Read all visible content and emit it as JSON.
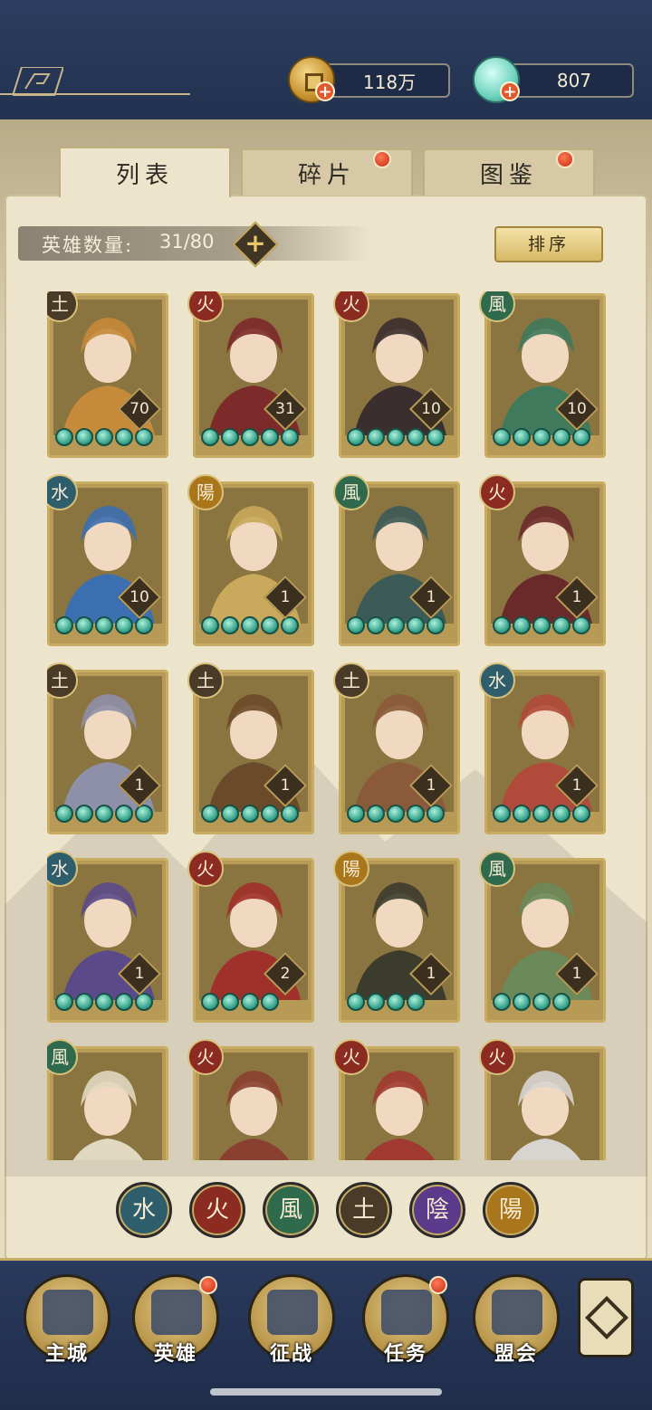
{
  "resources": {
    "coin": {
      "value": "118万",
      "icon": "copper-coin-icon"
    },
    "jade": {
      "value": "807",
      "icon": "jade-pouch-icon"
    }
  },
  "tabs": [
    {
      "label": "列表",
      "active": true,
      "badge": false
    },
    {
      "label": "碎片",
      "active": false,
      "badge": true
    },
    {
      "label": "图鉴",
      "active": false,
      "badge": true
    }
  ],
  "hero_count": {
    "label": "英雄数量:",
    "value": "31/80"
  },
  "sort_label": "排序",
  "heroes": [
    {
      "element": "土",
      "level": "70",
      "stars": 5
    },
    {
      "element": "火",
      "level": "31",
      "stars": 5
    },
    {
      "element": "火",
      "level": "10",
      "stars": 5
    },
    {
      "element": "風",
      "level": "10",
      "stars": 5
    },
    {
      "element": "水",
      "level": "10",
      "stars": 5
    },
    {
      "element": "陽",
      "level": "1",
      "stars": 5
    },
    {
      "element": "風",
      "level": "1",
      "stars": 5
    },
    {
      "element": "火",
      "level": "1",
      "stars": 5
    },
    {
      "element": "土",
      "level": "1",
      "stars": 5
    },
    {
      "element": "土",
      "level": "1",
      "stars": 5
    },
    {
      "element": "土",
      "level": "1",
      "stars": 5
    },
    {
      "element": "水",
      "level": "1",
      "stars": 5
    },
    {
      "element": "水",
      "level": "1",
      "stars": 5
    },
    {
      "element": "火",
      "level": "2",
      "stars": 4
    },
    {
      "element": "陽",
      "level": "1",
      "stars": 4
    },
    {
      "element": "風",
      "level": "1",
      "stars": 4
    },
    {
      "element": "風",
      "level": "",
      "stars": 0
    },
    {
      "element": "火",
      "level": "",
      "stars": 0
    },
    {
      "element": "火",
      "level": "",
      "stars": 0
    },
    {
      "element": "火",
      "level": "",
      "stars": 0
    }
  ],
  "element_filters": [
    "水",
    "火",
    "風",
    "土",
    "陰",
    "陽"
  ],
  "element_colors": {
    "水": "#2e5e6c",
    "火": "#8c2b22",
    "風": "#2f6a4d",
    "土": "#4a3b28",
    "陰": "#5b3a8c",
    "陽": "#a9761c"
  },
  "nav": [
    {
      "label": "主城",
      "icon": "city-gate-icon",
      "badge": false
    },
    {
      "label": "英雄",
      "icon": "hero-portrait-icon",
      "badge": true
    },
    {
      "label": "征战",
      "icon": "war-banner-icon",
      "badge": false
    },
    {
      "label": "任务",
      "icon": "scroll-task-icon",
      "badge": true
    },
    {
      "label": "盟会",
      "icon": "alliance-hall-icon",
      "badge": false
    }
  ],
  "menu_icon": "flower-menu-icon"
}
